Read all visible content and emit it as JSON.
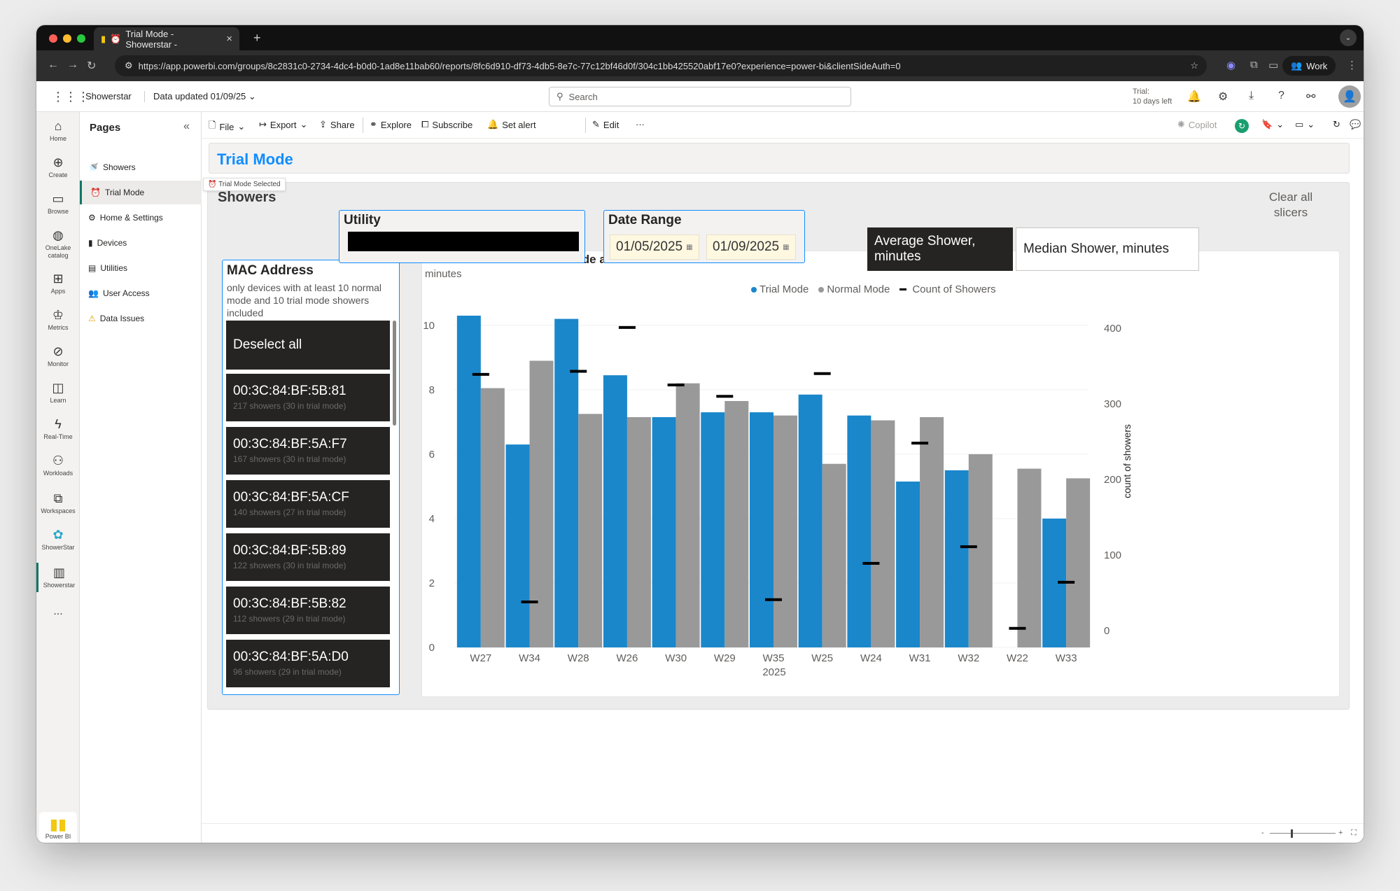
{
  "browser": {
    "tab_title": "Trial Mode - Showerstar -",
    "url": "https://app.powerbi.com/groups/8c2831c0-2734-4dc4-b0d0-1ad8e11bab60/reports/8fc6d910-df73-4db5-8e7c-77c12bf46d0f/304c1bb425520abf17e0?experience=power-bi&clientSideAuth=0",
    "profile": "Work"
  },
  "header": {
    "workspace": "Showerstar",
    "data_updated": "Data updated 01/09/25",
    "search_placeholder": "Search",
    "trial_line1": "Trial:",
    "trial_line2": "10 days left"
  },
  "rail": {
    "home": "Home",
    "create": "Create",
    "browse": "Browse",
    "onelake": "OneLake catalog",
    "apps": "Apps",
    "metrics": "Metrics",
    "monitor": "Monitor",
    "learn": "Learn",
    "realtime": "Real-Time",
    "workloads": "Workloads",
    "workspaces": "Workspaces",
    "showerstar_ws": "ShowerStar",
    "showerstar_report": "Showerstar",
    "more": "...",
    "powerbi": "Power BI"
  },
  "pages": {
    "title": "Pages",
    "items": [
      {
        "label": "Showers",
        "icon": "🚿"
      },
      {
        "label": "Trial Mode",
        "icon": "⏰"
      },
      {
        "label": "Home & Settings",
        "icon": "⚙"
      },
      {
        "label": "Devices",
        "icon": "▮"
      },
      {
        "label": "Utilities",
        "icon": "▤"
      },
      {
        "label": "User Access",
        "icon": "👥"
      },
      {
        "label": "Data Issues",
        "icon": "⚠"
      }
    ],
    "tooltip": "Trial Mode Selected"
  },
  "toolbar": {
    "file": "File",
    "export": "Export",
    "share": "Share",
    "explore": "Explore",
    "subscribe": "Subscribe",
    "set_alert": "Set alert",
    "edit": "Edit",
    "more": "···",
    "copilot": "Copilot"
  },
  "report": {
    "page_title": "Trial Mode",
    "section_title": "Showers",
    "clear_slicers": "Clear all slicers",
    "utility": {
      "title": "Utility"
    },
    "date_range": {
      "title": "Date Range",
      "start": "01/05/2025",
      "end": "01/09/2025"
    },
    "mac": {
      "title": "MAC Address",
      "subtitle": "only devices with at least 10 normal mode and 10 trial mode showers included",
      "deselect": "Deselect all",
      "items": [
        {
          "mac": "00:3C:84:BF:5B:81",
          "detail": "217 showers (30 in trial mode)"
        },
        {
          "mac": "00:3C:84:BF:5A:F7",
          "detail": "167 showers (30 in trial mode)"
        },
        {
          "mac": "00:3C:84:BF:5A:CF",
          "detail": "140 showers (27 in trial mode)"
        },
        {
          "mac": "00:3C:84:BF:5B:89",
          "detail": "122 showers (30 in trial mode)"
        },
        {
          "mac": "00:3C:84:BF:5B:82",
          "detail": "112 showers (29 in trial mode)"
        },
        {
          "mac": "00:3C:84:BF:5A:D0",
          "detail": "96 showers (29 in trial mode)"
        }
      ]
    },
    "toggle": {
      "average": "Average Shower, minutes",
      "median": "Median Shower, minutes"
    }
  },
  "chart_data": {
    "type": "bar",
    "title": "Shower Duration in Trial Mode and Normal Mode",
    "subtitle": "minutes",
    "xlabel": "2025",
    "ylabel": "",
    "y2label": "count of showers",
    "categories": [
      "W27",
      "W34",
      "W28",
      "W26",
      "W30",
      "W29",
      "W35",
      "W25",
      "W24",
      "W31",
      "W32",
      "W22",
      "W33"
    ],
    "series": [
      {
        "name": "Trial Mode",
        "color": "#1a87cb",
        "values": [
          10.3,
          6.3,
          10.2,
          8.45,
          7.15,
          7.3,
          7.3,
          7.85,
          7.2,
          5.15,
          5.5,
          0,
          4.0
        ]
      },
      {
        "name": "Normal Mode",
        "color": "#999999",
        "values": [
          8.05,
          8.9,
          7.25,
          7.15,
          8.2,
          7.65,
          7.2,
          5.7,
          7.05,
          7.15,
          6.0,
          5.55,
          5.25
        ]
      },
      {
        "name": "Count of Showers",
        "axis": "right",
        "marker": "dash",
        "color": "#000000",
        "values": [
          339,
          38,
          343,
          401,
          325,
          310,
          41,
          340,
          89,
          248,
          111,
          3,
          64
        ]
      }
    ],
    "ylim": [
      0,
      10.3
    ],
    "y_ticks": [
      "0",
      "2",
      "4",
      "6",
      "8",
      "10"
    ],
    "y2lim": [
      0,
      400
    ],
    "y2_ticks": [
      "0",
      "100",
      "200",
      "300",
      "400"
    ],
    "legend_position": "top-center",
    "grid": true
  }
}
